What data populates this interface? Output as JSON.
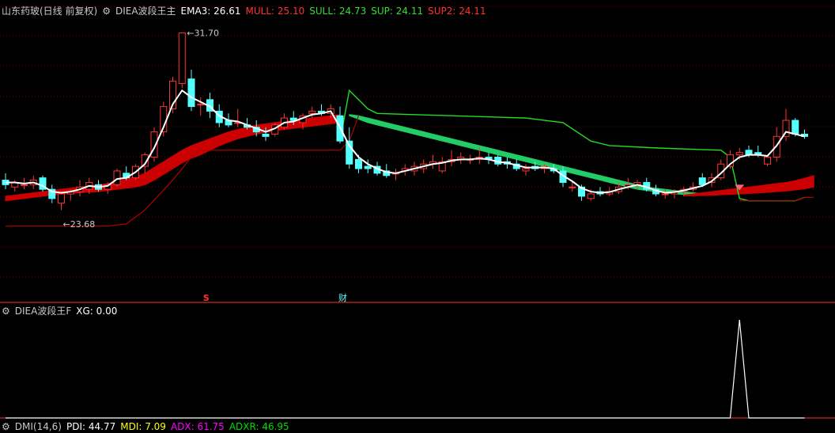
{
  "header": {
    "stock_title": "山东药玻(日线 前复权)",
    "indicator_name": "DIEA波段王主",
    "ema3": "EMA3: 26.61",
    "mull": "MULL: 25.10",
    "sull": "SULL: 24.73",
    "sup": "SUP: 24.11",
    "sup2": "SUP2: 24.11"
  },
  "sub_header": {
    "indicator_name": "DIEA波段王F",
    "xg": "XG: 0.00"
  },
  "dmi_header": {
    "name": "DMI(14,6)",
    "pdi": "PDI: 44.77",
    "mdi": "MDI: 7.09",
    "adx": "ADX: 61.75",
    "adxr": "ADXR: 46.95"
  },
  "annotations": {
    "high_label": "31.70",
    "low_label": "23.68",
    "marker_s": "S",
    "marker_cai": "财"
  },
  "colors": {
    "up": "#ff3232",
    "down": "#54ffff",
    "ema": "#ffffff",
    "band_red": "#cc0000",
    "band_green": "#22cc66",
    "sup_red": "#b00000",
    "sup_green": "#22dd22",
    "grid": "#7a0000",
    "text_red": "#ff3232",
    "text_green": "#00dd00",
    "text_magenta": "#ff00ff"
  },
  "chart_data": [
    {
      "type": "candlestick",
      "title": "山东药玻(日线 前复权)",
      "ylim": [
        22.6,
        32.1
      ],
      "grid": true,
      "candles": [
        {
          "o": 25.3,
          "h": 25.6,
          "l": 24.9,
          "c": 25.1
        },
        {
          "o": 25.0,
          "h": 25.3,
          "l": 24.8,
          "c": 25.2
        },
        {
          "o": 25.1,
          "h": 25.4,
          "l": 24.9,
          "c": 25.1
        },
        {
          "o": 25.1,
          "h": 25.5,
          "l": 24.9,
          "c": 25.3
        },
        {
          "o": 25.4,
          "h": 25.5,
          "l": 24.8,
          "c": 24.9
        },
        {
          "o": 24.9,
          "h": 25.1,
          "l": 24.3,
          "c": 24.5
        },
        {
          "o": 24.3,
          "h": 24.8,
          "l": 24.0,
          "c": 24.7
        },
        {
          "o": 24.7,
          "h": 24.9,
          "l": 24.4,
          "c": 24.8
        },
        {
          "o": 24.8,
          "h": 25.3,
          "l": 24.6,
          "c": 25.0
        },
        {
          "o": 24.9,
          "h": 25.4,
          "l": 24.7,
          "c": 25.2
        },
        {
          "o": 25.1,
          "h": 25.3,
          "l": 24.8,
          "c": 24.9
        },
        {
          "o": 24.9,
          "h": 25.2,
          "l": 24.7,
          "c": 25.1
        },
        {
          "o": 25.1,
          "h": 25.8,
          "l": 25.0,
          "c": 25.7
        },
        {
          "o": 25.6,
          "h": 25.9,
          "l": 25.3,
          "c": 25.4
        },
        {
          "o": 25.4,
          "h": 26.0,
          "l": 25.3,
          "c": 25.9
        },
        {
          "o": 25.9,
          "h": 26.5,
          "l": 25.6,
          "c": 26.4
        },
        {
          "o": 26.3,
          "h": 27.6,
          "l": 26.1,
          "c": 27.4
        },
        {
          "o": 27.4,
          "h": 28.7,
          "l": 27.2,
          "c": 28.5
        },
        {
          "o": 28.4,
          "h": 29.8,
          "l": 28.2,
          "c": 29.6
        },
        {
          "o": 29.5,
          "h": 31.7,
          "l": 29.3,
          "c": 31.7
        },
        {
          "o": 29.7,
          "h": 30.1,
          "l": 28.3,
          "c": 28.5
        },
        {
          "o": 28.6,
          "h": 28.9,
          "l": 28.1,
          "c": 28.6
        },
        {
          "o": 28.8,
          "h": 29.1,
          "l": 28.0,
          "c": 28.3
        },
        {
          "o": 28.3,
          "h": 28.6,
          "l": 27.6,
          "c": 27.8
        },
        {
          "o": 27.9,
          "h": 28.2,
          "l": 27.6,
          "c": 27.7
        },
        {
          "o": 27.8,
          "h": 28.4,
          "l": 27.6,
          "c": 27.8
        },
        {
          "o": 27.7,
          "h": 28.0,
          "l": 27.5,
          "c": 27.6
        },
        {
          "o": 27.6,
          "h": 27.9,
          "l": 27.2,
          "c": 27.4
        },
        {
          "o": 27.3,
          "h": 27.6,
          "l": 27.0,
          "c": 27.2
        },
        {
          "o": 27.3,
          "h": 27.8,
          "l": 27.2,
          "c": 27.7
        },
        {
          "o": 27.6,
          "h": 28.2,
          "l": 27.5,
          "c": 28.0
        },
        {
          "o": 28.0,
          "h": 28.3,
          "l": 27.7,
          "c": 27.9
        },
        {
          "o": 27.8,
          "h": 28.2,
          "l": 27.5,
          "c": 28.1
        },
        {
          "o": 28.2,
          "h": 28.5,
          "l": 28.0,
          "c": 28.3
        },
        {
          "o": 28.3,
          "h": 28.6,
          "l": 28.1,
          "c": 28.2
        },
        {
          "o": 28.2,
          "h": 28.6,
          "l": 28.0,
          "c": 28.4
        },
        {
          "o": 28.1,
          "h": 28.5,
          "l": 26.9,
          "c": 27.0
        },
        {
          "o": 27.0,
          "h": 27.6,
          "l": 25.8,
          "c": 26.0
        },
        {
          "o": 26.2,
          "h": 26.4,
          "l": 25.6,
          "c": 25.8
        },
        {
          "o": 25.9,
          "h": 26.2,
          "l": 25.6,
          "c": 25.8
        },
        {
          "o": 25.9,
          "h": 26.1,
          "l": 25.5,
          "c": 25.6
        },
        {
          "o": 25.7,
          "h": 26.0,
          "l": 25.4,
          "c": 25.5
        },
        {
          "o": 25.6,
          "h": 25.8,
          "l": 25.3,
          "c": 25.6
        },
        {
          "o": 25.7,
          "h": 26.0,
          "l": 25.5,
          "c": 25.8
        },
        {
          "o": 25.7,
          "h": 26.1,
          "l": 25.5,
          "c": 25.9
        },
        {
          "o": 25.8,
          "h": 26.2,
          "l": 25.6,
          "c": 26.0
        },
        {
          "o": 26.0,
          "h": 26.4,
          "l": 25.8,
          "c": 26.1
        },
        {
          "o": 25.7,
          "h": 26.3,
          "l": 25.6,
          "c": 26.1
        },
        {
          "o": 26.1,
          "h": 26.6,
          "l": 25.9,
          "c": 26.2
        },
        {
          "o": 26.2,
          "h": 26.5,
          "l": 26.0,
          "c": 26.3
        },
        {
          "o": 26.2,
          "h": 26.4,
          "l": 26.0,
          "c": 26.2
        },
        {
          "o": 26.2,
          "h": 26.7,
          "l": 26.0,
          "c": 26.3
        },
        {
          "o": 26.3,
          "h": 26.5,
          "l": 26.0,
          "c": 26.2
        },
        {
          "o": 26.3,
          "h": 26.4,
          "l": 25.9,
          "c": 26.0
        },
        {
          "o": 26.1,
          "h": 26.3,
          "l": 25.8,
          "c": 26.0
        },
        {
          "o": 26.0,
          "h": 26.2,
          "l": 25.7,
          "c": 25.8
        },
        {
          "o": 25.7,
          "h": 26.0,
          "l": 25.5,
          "c": 25.8
        },
        {
          "o": 25.9,
          "h": 26.1,
          "l": 25.7,
          "c": 25.8
        },
        {
          "o": 25.8,
          "h": 26.0,
          "l": 25.6,
          "c": 25.9
        },
        {
          "o": 25.8,
          "h": 26.0,
          "l": 25.6,
          "c": 25.7
        },
        {
          "o": 25.7,
          "h": 25.9,
          "l": 25.0,
          "c": 25.2
        },
        {
          "o": 25.0,
          "h": 25.3,
          "l": 24.8,
          "c": 25.0
        },
        {
          "o": 25.0,
          "h": 25.1,
          "l": 24.4,
          "c": 24.6
        },
        {
          "o": 24.5,
          "h": 24.9,
          "l": 24.4,
          "c": 24.7
        },
        {
          "o": 24.8,
          "h": 25.0,
          "l": 24.6,
          "c": 24.7
        },
        {
          "o": 24.7,
          "h": 25.0,
          "l": 24.6,
          "c": 24.8
        },
        {
          "o": 24.8,
          "h": 25.2,
          "l": 24.7,
          "c": 25.0
        },
        {
          "o": 25.0,
          "h": 25.4,
          "l": 24.9,
          "c": 25.1
        },
        {
          "o": 25.1,
          "h": 25.3,
          "l": 24.9,
          "c": 25.2
        },
        {
          "o": 25.2,
          "h": 25.4,
          "l": 24.8,
          "c": 24.9
        },
        {
          "o": 24.9,
          "h": 25.1,
          "l": 24.6,
          "c": 24.7
        },
        {
          "o": 24.7,
          "h": 24.9,
          "l": 24.5,
          "c": 24.7
        },
        {
          "o": 24.7,
          "h": 24.9,
          "l": 24.5,
          "c": 24.8
        },
        {
          "o": 24.8,
          "h": 25.0,
          "l": 24.6,
          "c": 24.9
        },
        {
          "o": 24.9,
          "h": 25.2,
          "l": 24.8,
          "c": 25.0
        },
        {
          "o": 25.4,
          "h": 25.6,
          "l": 25.0,
          "c": 25.1
        },
        {
          "o": 25.2,
          "h": 25.6,
          "l": 25.0,
          "c": 25.4
        },
        {
          "o": 25.4,
          "h": 26.2,
          "l": 25.3,
          "c": 26.0
        },
        {
          "o": 25.9,
          "h": 26.6,
          "l": 25.8,
          "c": 26.4
        },
        {
          "o": 26.4,
          "h": 26.7,
          "l": 26.2,
          "c": 26.5
        },
        {
          "o": 26.6,
          "h": 26.8,
          "l": 26.3,
          "c": 26.4
        },
        {
          "o": 26.5,
          "h": 26.8,
          "l": 26.3,
          "c": 26.4
        },
        {
          "o": 26.0,
          "h": 26.4,
          "l": 25.9,
          "c": 26.3
        },
        {
          "o": 26.3,
          "h": 27.6,
          "l": 26.1,
          "c": 27.2
        },
        {
          "o": 27.2,
          "h": 28.4,
          "l": 27.0,
          "c": 27.9
        },
        {
          "o": 27.9,
          "h": 28.0,
          "l": 27.2,
          "c": 27.3
        },
        {
          "o": 27.3,
          "h": 27.5,
          "l": 27.1,
          "c": 27.2
        }
      ],
      "ema": [
        25.2,
        25.2,
        25.15,
        25.2,
        25.05,
        24.8,
        24.75,
        24.8,
        24.9,
        25.05,
        25.0,
        25.05,
        25.35,
        25.4,
        25.65,
        26.0,
        26.7,
        27.6,
        28.6,
        29.2,
        28.9,
        28.7,
        28.5,
        28.1,
        27.9,
        27.85,
        27.7,
        27.55,
        27.4,
        27.55,
        27.8,
        27.85,
        28.0,
        28.15,
        28.2,
        28.3,
        27.6,
        26.8,
        26.3,
        26.0,
        25.8,
        25.65,
        25.6,
        25.7,
        25.8,
        25.9,
        26.0,
        26.05,
        26.15,
        26.2,
        26.2,
        26.25,
        26.2,
        26.1,
        26.05,
        25.95,
        25.85,
        25.85,
        25.85,
        25.8,
        25.5,
        25.25,
        24.95,
        24.8,
        24.75,
        24.78,
        24.9,
        25.0,
        25.1,
        25.0,
        24.85,
        24.75,
        24.78,
        24.85,
        24.95,
        25.05,
        25.25,
        25.6,
        26.0,
        26.3,
        26.4,
        26.4,
        26.35,
        26.8,
        27.4,
        27.3,
        27.2
      ],
      "band_red_top": [
        24.6,
        24.65,
        24.7,
        24.75,
        24.8,
        24.85,
        24.9,
        24.95,
        25.0,
        25.05,
        25.1,
        25.15,
        25.25,
        25.35,
        25.45,
        25.6,
        25.85,
        26.1,
        26.35,
        26.6,
        26.8,
        26.95,
        27.1,
        27.25,
        27.4,
        27.5,
        27.6,
        27.7,
        27.75,
        27.8,
        27.85,
        27.9,
        27.95,
        28.0,
        28.05,
        28.1,
        28.15
      ],
      "band_red_bottom": [
        24.4,
        24.45,
        24.5,
        24.55,
        24.6,
        24.65,
        24.7,
        24.72,
        24.75,
        24.78,
        24.8,
        24.85,
        24.9,
        24.95,
        25.0,
        25.1,
        25.3,
        25.55,
        25.8,
        26.05,
        26.25,
        26.4,
        26.6,
        26.8,
        26.95,
        27.1,
        27.2,
        27.3,
        27.38,
        27.45,
        27.5,
        27.55,
        27.6,
        27.65,
        27.7,
        27.75,
        27.8
      ],
      "band_green_top": [
        28.15,
        28.1,
        28.0,
        27.9,
        27.8,
        27.7,
        27.6,
        27.5,
        27.4,
        27.3,
        27.2,
        27.1,
        27.0,
        26.9,
        26.8,
        26.7,
        26.6,
        26.5,
        26.4,
        26.3,
        26.2,
        26.1,
        26.0,
        25.9,
        25.8,
        25.7,
        25.6,
        25.5,
        25.4,
        25.3,
        25.2,
        25.1,
        25.0,
        24.95,
        24.9,
        24.85,
        24.8,
        24.75,
        24.7
      ],
      "band_green_bottom": [
        28.1,
        27.95,
        27.8,
        27.7,
        27.6,
        27.5,
        27.4,
        27.3,
        27.2,
        27.1,
        27.0,
        26.9,
        26.8,
        26.7,
        26.6,
        26.5,
        26.4,
        26.3,
        26.2,
        26.1,
        26.0,
        25.9,
        25.8,
        25.7,
        25.6,
        25.5,
        25.4,
        25.3,
        25.2,
        25.1,
        25.0,
        24.9,
        24.85,
        24.8,
        24.75,
        24.7,
        24.68,
        24.66,
        24.65
      ],
      "band_red2_top": [
        24.65,
        24.7,
        24.75,
        24.8,
        24.85,
        24.9,
        24.95,
        25.0,
        25.05,
        25.1,
        25.15,
        25.2,
        25.28,
        25.38,
        25.5
      ],
      "band_red2_bottom": [
        24.62,
        24.62,
        24.63,
        24.64,
        24.66,
        24.68,
        24.7,
        24.72,
        24.74,
        24.77,
        24.8,
        24.83,
        24.87,
        24.92,
        25.0
      ],
      "sup_red": [
        [
          0,
          23.3
        ],
        [
          11,
          23.3
        ],
        [
          13,
          23.4
        ],
        [
          15,
          24.0
        ],
        [
          18,
          25.3
        ],
        [
          20,
          26.3
        ],
        [
          21,
          26.6
        ],
        [
          29,
          26.6
        ],
        [
          36,
          26.6
        ],
        [
          37,
          27.0
        ],
        [
          38,
          28.1
        ]
      ],
      "sup_green": [
        [
          36,
          27.0
        ],
        [
          37,
          29.2
        ],
        [
          38,
          28.8
        ],
        [
          39,
          28.4
        ],
        [
          40,
          28.2
        ],
        [
          48,
          28.1
        ],
        [
          56,
          28.0
        ],
        [
          60,
          27.8
        ],
        [
          63,
          27.0
        ],
        [
          65,
          26.8
        ],
        [
          70,
          26.7
        ],
        [
          77,
          26.6
        ],
        [
          78,
          26.3
        ],
        [
          79,
          24.5
        ],
        [
          80,
          24.4
        ],
        [
          85,
          24.4
        ],
        [
          86,
          24.55
        ]
      ],
      "sup_red_tail": [
        [
          79,
          24.4
        ],
        [
          85,
          24.4
        ],
        [
          86,
          24.55
        ],
        [
          87,
          24.55
        ]
      ]
    },
    {
      "type": "line",
      "title": "DIEA波段王F",
      "ylim": [
        0,
        1
      ],
      "series": [
        {
          "values": [
            0,
            0,
            0,
            0,
            0,
            0,
            0,
            0,
            0,
            0,
            0,
            0,
            0,
            0,
            0,
            0,
            0,
            0,
            0,
            0,
            0,
            0,
            0,
            0,
            0,
            0,
            0,
            0,
            0,
            0,
            0,
            0,
            0,
            0,
            0,
            0,
            0,
            0,
            0,
            0,
            0,
            0,
            0,
            0,
            0,
            0,
            0,
            0,
            0,
            0,
            0,
            0,
            0,
            0,
            0,
            0,
            0,
            0,
            0,
            0,
            0,
            0,
            0,
            0,
            0,
            0,
            0,
            0,
            0,
            0,
            0,
            0,
            0,
            0,
            0,
            0,
            0,
            0,
            0,
            1,
            0,
            0,
            0,
            0,
            0,
            0,
            0
          ]
        }
      ]
    }
  ]
}
